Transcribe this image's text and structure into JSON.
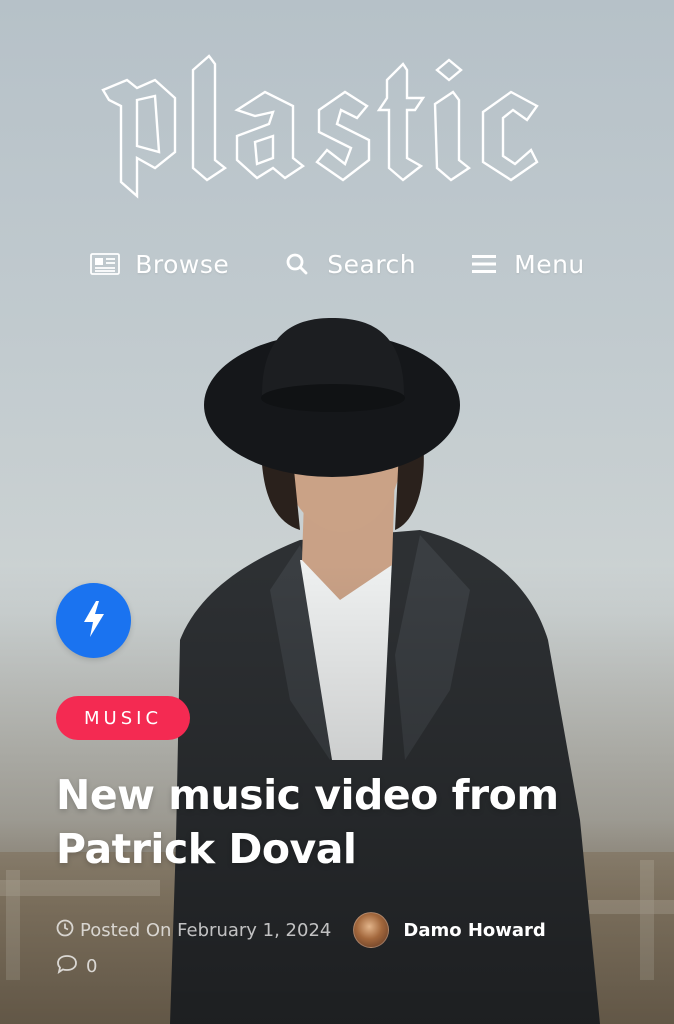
{
  "brand": {
    "logo_text": "plastic"
  },
  "nav": {
    "browse_label": "Browse",
    "search_label": "Search",
    "menu_label": "Menu"
  },
  "post": {
    "category": "MUSIC",
    "title": "New music video from Patrick Doval",
    "date_text": "Posted On February 1, 2024",
    "author": "Damo Howard",
    "comment_count": "0"
  },
  "colors": {
    "accent_blue": "#1a73f0",
    "category_red": "#f42a52",
    "text_white": "#ffffff"
  },
  "icons": {
    "browse": "newspaper-icon",
    "search": "search-icon",
    "menu": "hamburger-icon",
    "badge": "lightning-bolt-icon",
    "date": "clock-icon",
    "comments": "speech-bubble-icon"
  }
}
